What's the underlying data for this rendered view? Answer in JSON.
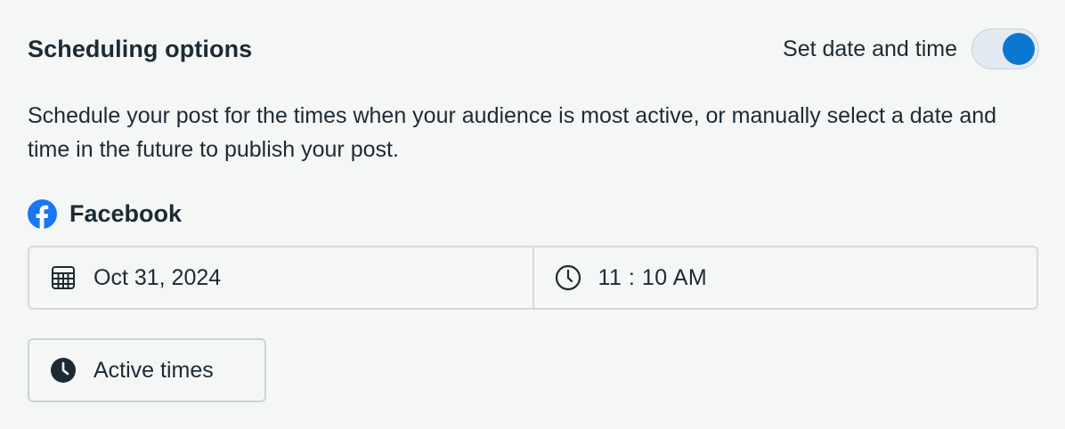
{
  "header": {
    "title": "Scheduling options",
    "toggle_label": "Set date and time",
    "toggle_on": true
  },
  "description": "Schedule your post for the times when your audience is most active, or manually select a date and time in the future to publish your post.",
  "platform": {
    "name": "Facebook",
    "icon": "facebook-icon"
  },
  "schedule": {
    "date": "Oct 31, 2024",
    "date_icon": "calendar-icon",
    "time_hour": "11",
    "time_separator": ":",
    "time_minute": "10",
    "time_period": "AM",
    "time_icon": "clock-icon"
  },
  "active_times": {
    "label": "Active times",
    "icon": "clock-filled-icon"
  },
  "colors": {
    "accent": "#0a78d1",
    "facebook": "#1877f2",
    "text": "#1c2b33",
    "border": "#d6dadd",
    "background": "#f5f6f6"
  }
}
